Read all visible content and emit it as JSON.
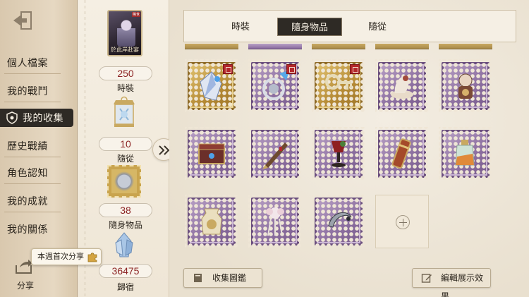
{
  "nav": {
    "items": [
      {
        "label": "個人檔案",
        "active": false
      },
      {
        "label": "我的戰鬥",
        "active": false
      },
      {
        "label": "我的收集",
        "active": true
      },
      {
        "label": "歷史戰績",
        "active": false
      },
      {
        "label": "角色認知",
        "active": false
      },
      {
        "label": "我的成就",
        "active": false
      },
      {
        "label": "我的關係",
        "active": false
      }
    ],
    "share_label": "分享",
    "toast_label": "本週首次分享"
  },
  "stats": {
    "card_caption": "於此岸赴宴",
    "card_tag": "稀世",
    "costume": {
      "value": "250",
      "label": "時裝"
    },
    "pet": {
      "value": "10",
      "label": "隨從"
    },
    "accessory": {
      "value": "38",
      "label": "隨身物品"
    },
    "home": {
      "value": "36475",
      "label": "歸宿"
    }
  },
  "tabs": [
    {
      "label": "時裝",
      "active": false
    },
    {
      "label": "隨身物品",
      "active": true
    },
    {
      "label": "隨從",
      "active": false
    }
  ],
  "grid": {
    "rows": [
      [
        {
          "rarity": "gold",
          "icon": "crystal-shard-icon",
          "seal": true,
          "rank": "III"
        },
        {
          "rarity": "purple",
          "icon": "silver-lace-icon",
          "seal": true,
          "rank": ""
        },
        {
          "rarity": "gold",
          "icon": "ornate-key-icon",
          "seal": true,
          "rank": "III"
        },
        {
          "rarity": "purple",
          "icon": "figurine-icon",
          "seal": false,
          "rank": ""
        },
        {
          "rarity": "purple",
          "icon": "clockwork-doll-icon",
          "seal": false,
          "rank": ""
        }
      ],
      [
        {
          "rarity": "purple",
          "icon": "jewel-box-icon",
          "seal": false,
          "rank": ""
        },
        {
          "rarity": "purple",
          "icon": "pen-blade-icon",
          "seal": false,
          "rank": ""
        },
        {
          "rarity": "purple",
          "icon": "red-goblet-icon",
          "seal": false,
          "rank": ""
        },
        {
          "rarity": "purple",
          "icon": "scroll-tube-icon",
          "seal": false,
          "rank": ""
        },
        {
          "rarity": "purple",
          "icon": "potion-bottle-icon",
          "seal": false,
          "rank": ""
        }
      ],
      [
        {
          "rarity": "purple",
          "icon": "glass-jar-icon",
          "seal": false,
          "rank": ""
        },
        {
          "rarity": "purple",
          "icon": "flower-tassel-icon",
          "seal": false,
          "rank": ""
        },
        {
          "rarity": "purple",
          "icon": "crescent-blade-icon",
          "seal": false,
          "rank": ""
        },
        {
          "rarity": "empty",
          "icon": "plus-icon",
          "seal": false,
          "rank": ""
        }
      ]
    ]
  },
  "buttons": {
    "catalog": "收集圖鑑",
    "edit_display": "編輯展示效果"
  },
  "colors": {
    "nav_active_bg": "#2e2a25",
    "stat_number": "#8c2424",
    "gold_stamp": "#c9a44e",
    "purple_stamp": "#8c6fa0"
  }
}
